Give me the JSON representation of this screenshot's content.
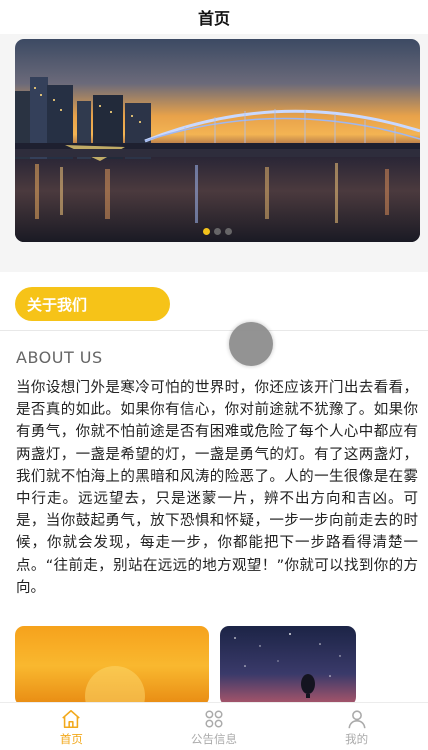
{
  "navbar": {
    "title": "首页"
  },
  "banner": {
    "slides": 3,
    "active_index": 0,
    "indicator_active_color": "#f2c21b"
  },
  "about": {
    "badge": "关于我们",
    "subtitle": "ABOUT US",
    "body": "当你设想门外是寒冷可怕的世界时，你还应该开门出去看看，是否真的如此。如果你有信心，你对前途就不犹豫了。如果你有勇气，你就不怕前途是否有困难或危险了每个人心中都应有两盏灯，一盏是希望的灯，一盏是勇气的灯。有了这两盏灯，我们就不怕海上的黑暗和风涛的险恶了。人的一生很像是在雾中行走。远远望去，只是迷蒙一片，辨不出方向和吉凶。可是，当你鼓起勇气，放下恐惧和怀疑，一步一步向前走去的时候，你就会发现，每走一步，你都能把下一步路看得清楚一点。“往前走，别站在远远的地方观望！”你就可以找到你的方向。",
    "accent_color": "#f6c318"
  },
  "tabbar": {
    "items": [
      {
        "label": "首页",
        "icon": "home-icon",
        "active": true
      },
      {
        "label": "公告信息",
        "icon": "grid-icon",
        "active": false
      },
      {
        "label": "我的",
        "icon": "user-icon",
        "active": false
      }
    ],
    "active_color": "#f2a91c",
    "inactive_color": "#aaaaaa"
  }
}
